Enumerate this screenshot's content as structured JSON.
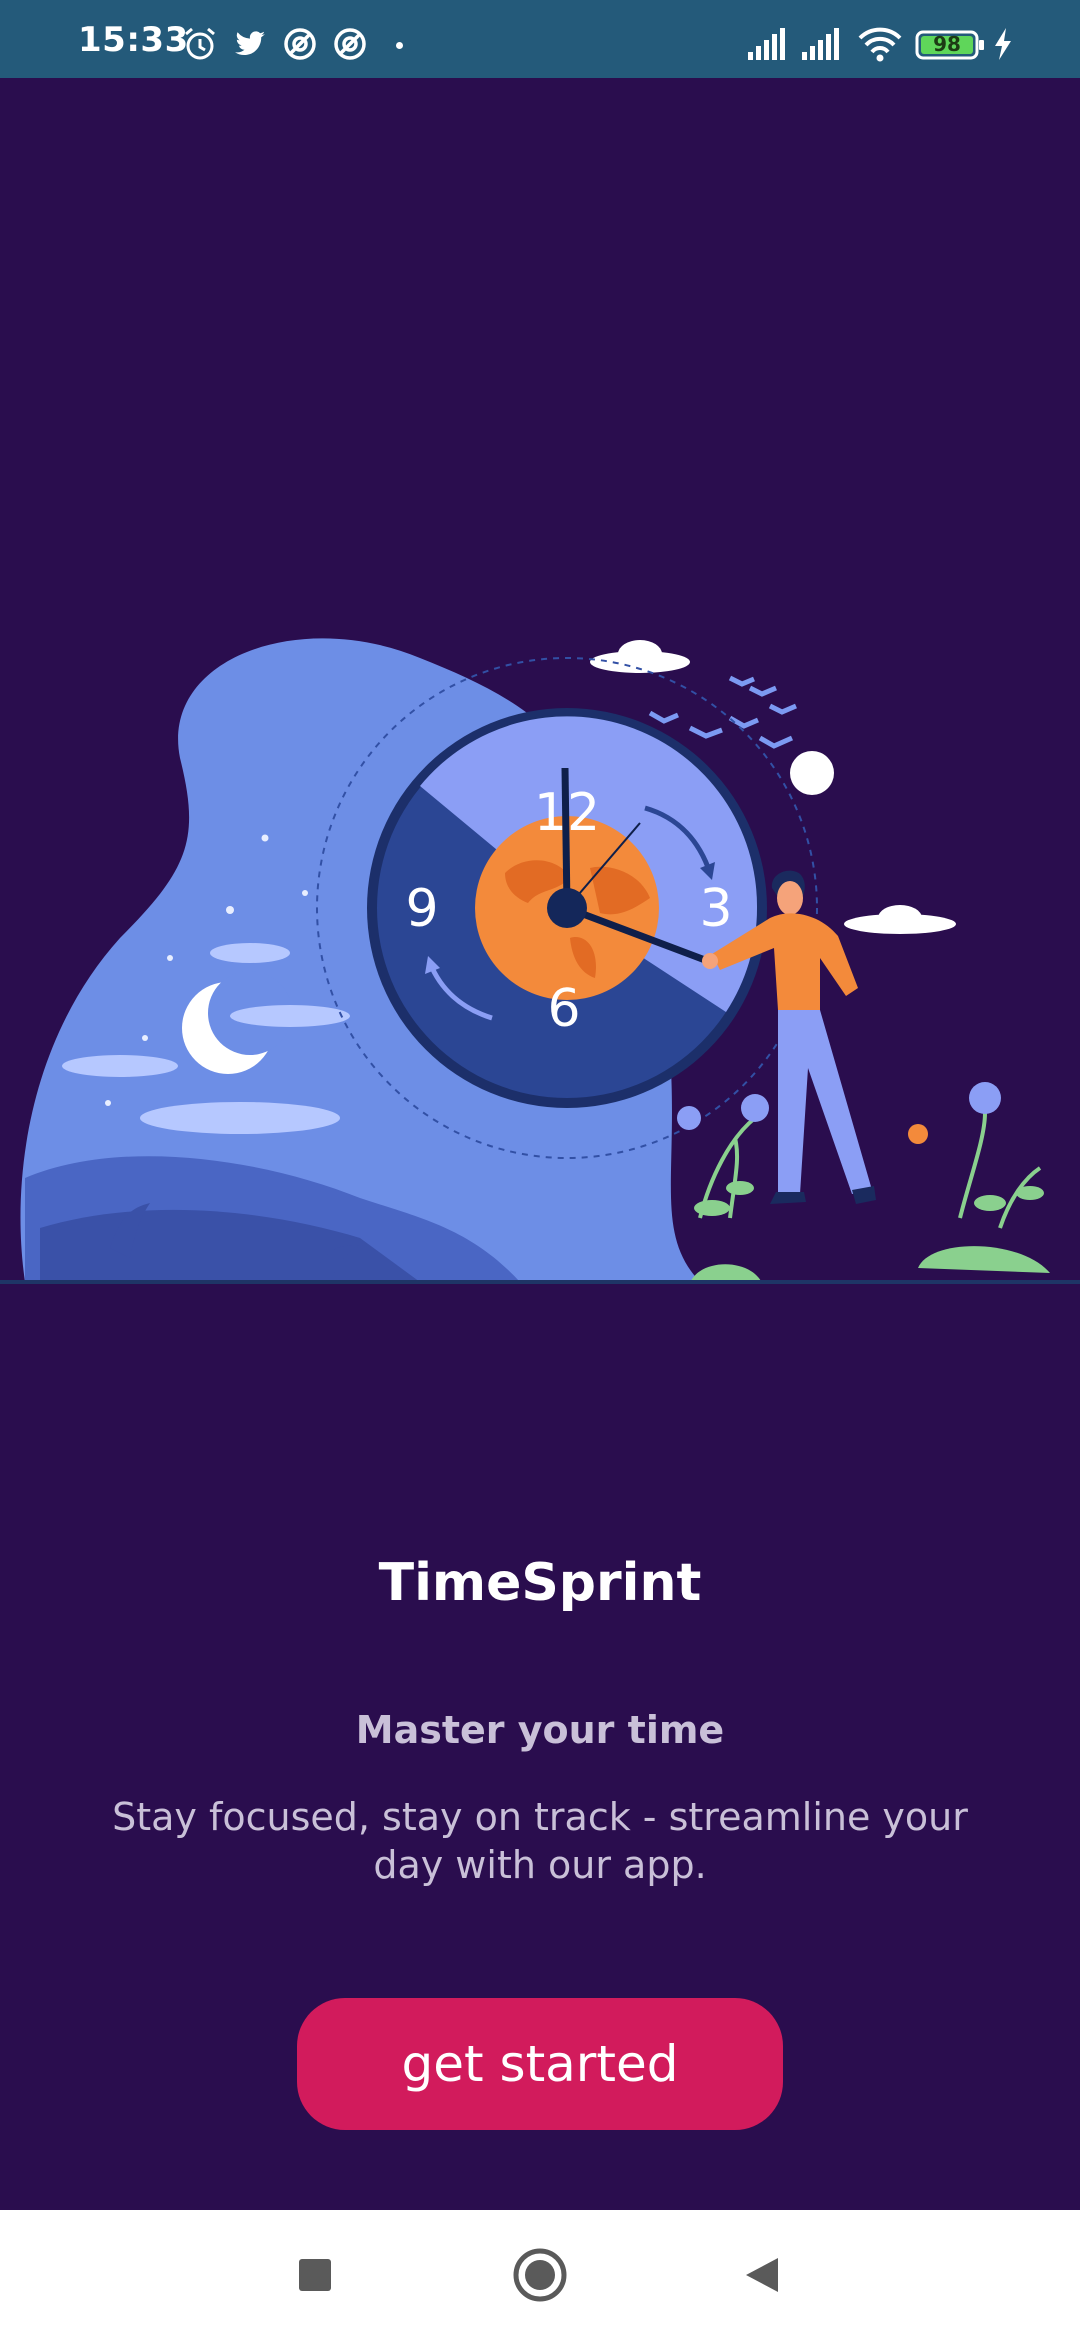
{
  "status_bar": {
    "time": "15:33",
    "battery": "98",
    "icons": [
      "alarm-icon",
      "twitter-icon",
      "app-notification-icon",
      "app-notification-icon",
      "dot-icon",
      "signal-icon",
      "signal-icon",
      "wifi-icon",
      "battery-icon",
      "charging-icon"
    ]
  },
  "illustration": {
    "clock_labels": {
      "n12": "12",
      "n3": "3",
      "n6": "6",
      "n9": "9"
    }
  },
  "content": {
    "title": "TimeSprint",
    "subtitle": "Master your time",
    "description": "Stay focused, stay on track - streamline your day with our app.",
    "cta_label": "get started"
  },
  "nav": {
    "icons": [
      "recents-square-icon",
      "home-circle-icon",
      "back-triangle-icon"
    ]
  },
  "colors": {
    "background": "#2a0d4e",
    "status_bar": "#245a7a",
    "accent": "#d21b5c"
  }
}
